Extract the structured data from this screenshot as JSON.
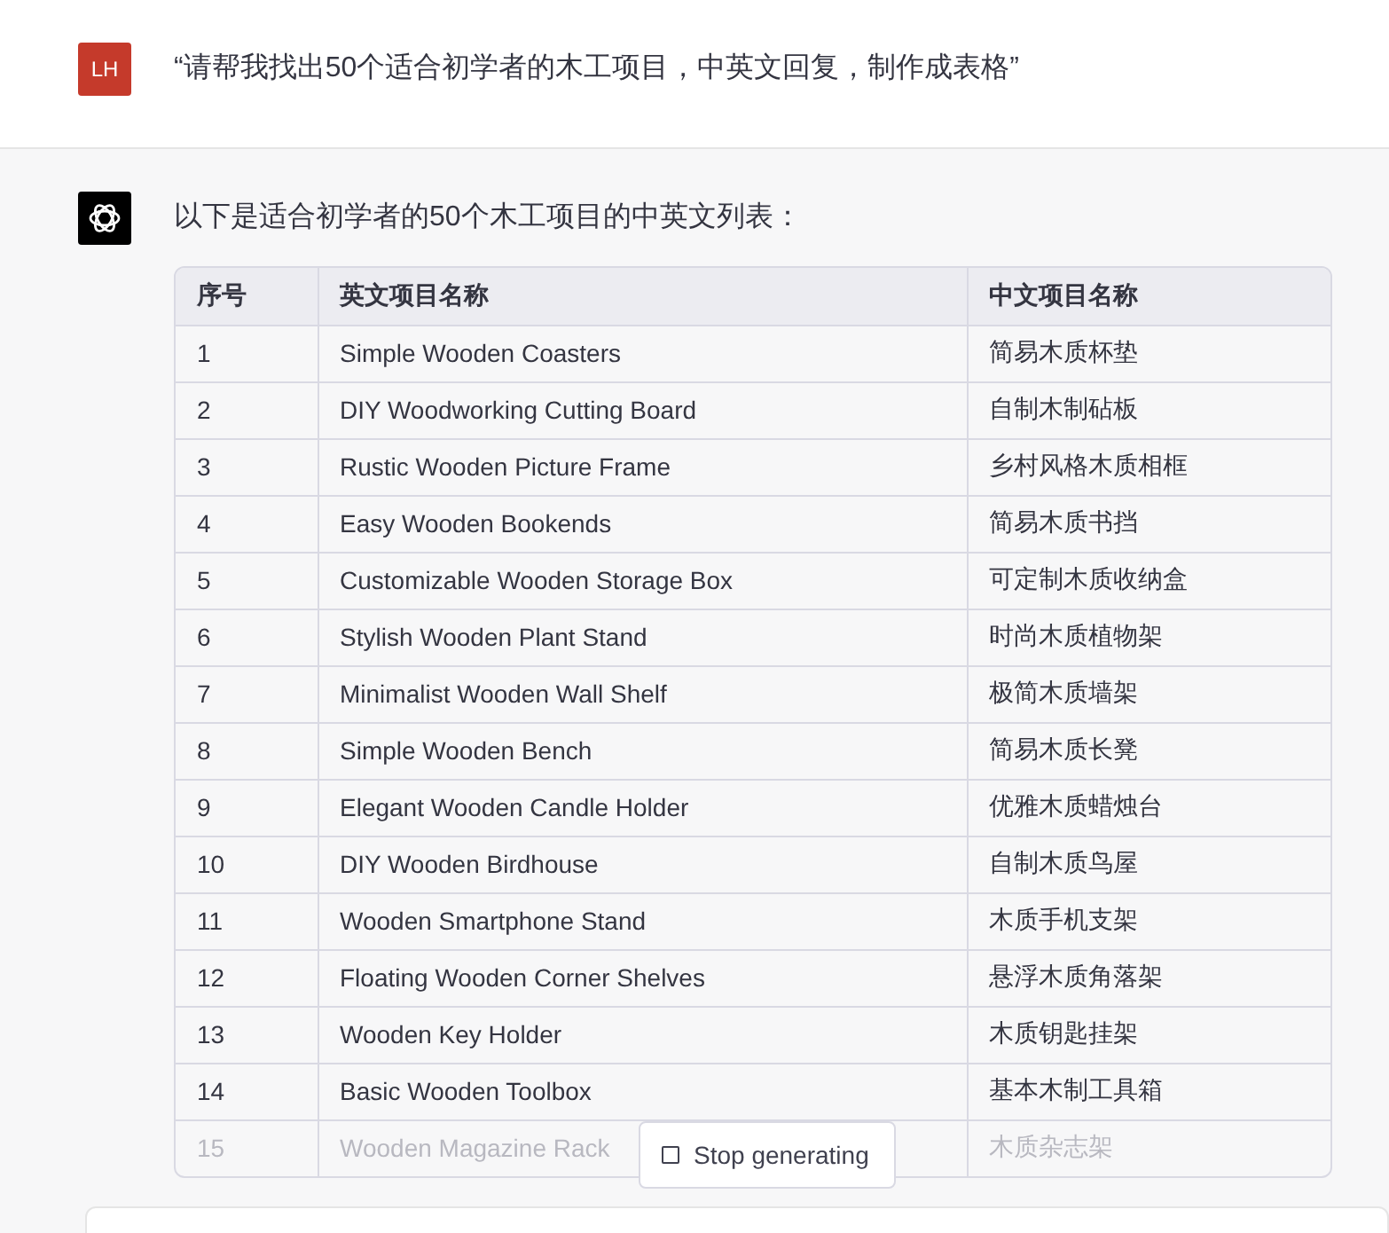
{
  "user_message": {
    "avatar": "LH",
    "text": "“请帮我找出50个适合初学者的木工项目，中英文回复，制作成表格”"
  },
  "assistant_message": {
    "intro": "以下是适合初学者的50个木工项目的中英文列表：",
    "table": {
      "columns": [
        "序号",
        "英文项目名称",
        "中文项目名称"
      ],
      "rows": [
        {
          "cells": [
            "1",
            "Simple Wooden Coasters",
            "简易木质杯垫"
          ],
          "faded": false
        },
        {
          "cells": [
            "2",
            "DIY Woodworking Cutting Board",
            "自制木制砧板"
          ],
          "faded": false
        },
        {
          "cells": [
            "3",
            "Rustic Wooden Picture Frame",
            "乡村风格木质相框"
          ],
          "faded": false
        },
        {
          "cells": [
            "4",
            "Easy Wooden Bookends",
            "简易木质书挡"
          ],
          "faded": false
        },
        {
          "cells": [
            "5",
            "Customizable Wooden Storage Box",
            "可定制木质收纳盒"
          ],
          "faded": false
        },
        {
          "cells": [
            "6",
            "Stylish Wooden Plant Stand",
            "时尚木质植物架"
          ],
          "faded": false
        },
        {
          "cells": [
            "7",
            "Minimalist Wooden Wall Shelf",
            "极简木质墙架"
          ],
          "faded": false
        },
        {
          "cells": [
            "8",
            "Simple Wooden Bench",
            "简易木质长凳"
          ],
          "faded": false
        },
        {
          "cells": [
            "9",
            "Elegant Wooden Candle Holder",
            "优雅木质蜡烛台"
          ],
          "faded": false
        },
        {
          "cells": [
            "10",
            "DIY Wooden Birdhouse",
            "自制木质鸟屋"
          ],
          "faded": false
        },
        {
          "cells": [
            "11",
            "Wooden Smartphone Stand",
            "木质手机支架"
          ],
          "faded": false
        },
        {
          "cells": [
            "12",
            "Floating Wooden Corner Shelves",
            "悬浮木质角落架"
          ],
          "faded": false
        },
        {
          "cells": [
            "13",
            "Wooden Key Holder",
            "木质钥匙挂架"
          ],
          "faded": false
        },
        {
          "cells": [
            "14",
            "Basic Wooden Toolbox",
            "基本木制工具箱"
          ],
          "faded": false
        },
        {
          "cells": [
            "15",
            "Wooden Magazine Rack",
            "木质杂志架"
          ],
          "faded": true
        }
      ]
    }
  },
  "stop_button": {
    "label": "Stop generating"
  }
}
